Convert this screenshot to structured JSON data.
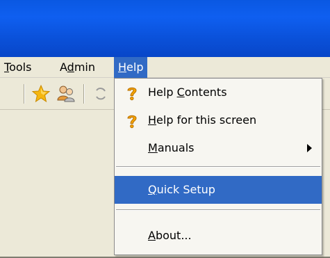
{
  "menubar": {
    "items": [
      {
        "label": "Tools",
        "ul": "T",
        "rest": "ools"
      },
      {
        "label": "Admin",
        "pre": "A",
        "ul": "d",
        "rest": "min"
      },
      {
        "label": "Help",
        "ul": "H",
        "rest": "elp"
      }
    ]
  },
  "toolbar": {
    "icons": [
      "star-icon",
      "users-icon",
      "refresh-icon"
    ]
  },
  "help_menu": {
    "items": [
      {
        "label": "Help Contents",
        "pre": "Help ",
        "ul": "C",
        "rest": "ontents",
        "icon": "help-question-icon"
      },
      {
        "label": "Help for this screen",
        "pre": "",
        "ul": "H",
        "rest": "elp for this screen",
        "icon": "help-question-icon"
      },
      {
        "label": "Manuals",
        "pre": "",
        "ul": "M",
        "rest": "anuals",
        "submenu": true
      },
      {
        "label": "Quick Setup",
        "pre": "",
        "ul": "Q",
        "rest": "uick Setup",
        "highlighted": true
      },
      {
        "label": "About...",
        "pre": "",
        "ul": "A",
        "rest": "bout..."
      }
    ]
  },
  "colors": {
    "titlebar": "#0a58e2",
    "menu_highlight": "#316ac5",
    "menubar_bg": "#ece9d8",
    "menu_bg": "#f7f6f1"
  }
}
